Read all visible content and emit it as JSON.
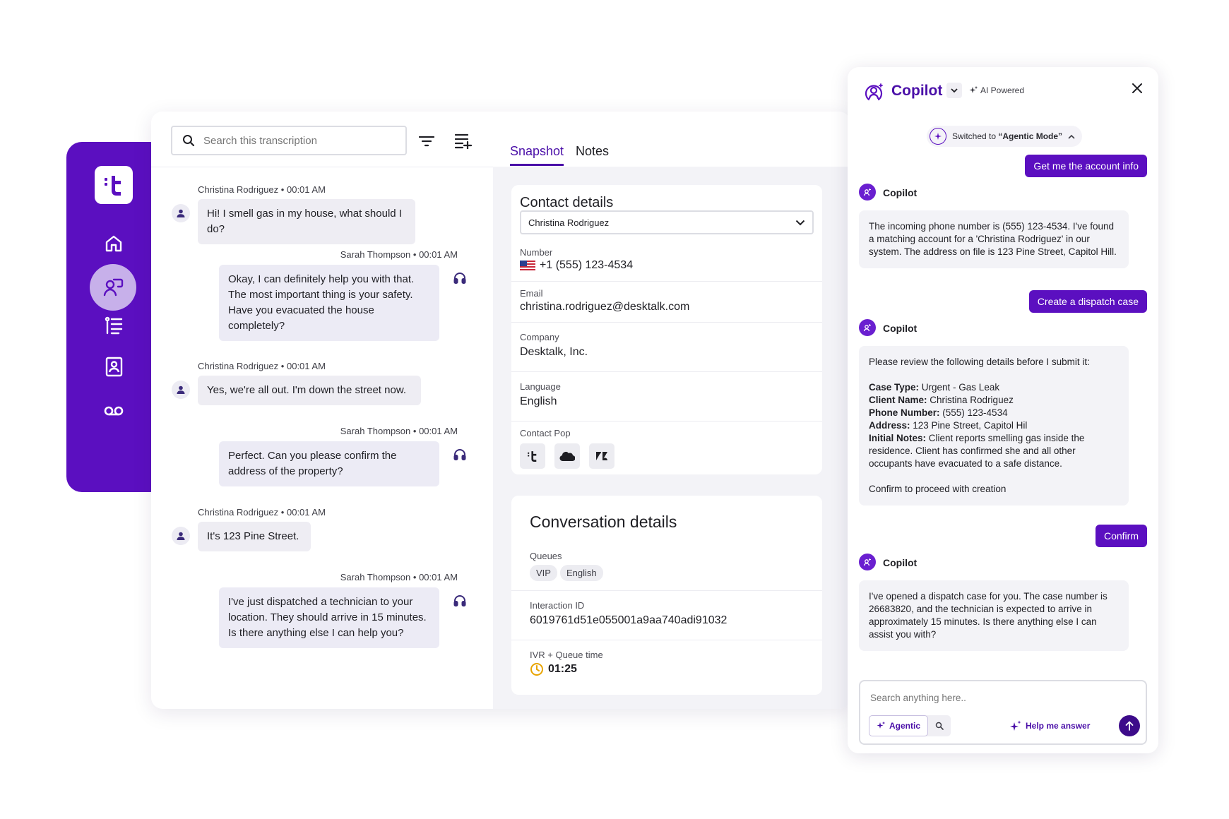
{
  "colors": {
    "brand": "#5b0fc0",
    "brand_dark": "#4a0fa8",
    "bubble": "#eeedf3",
    "clock": "#e8a400"
  },
  "sidebar": {
    "logo_icon": "brand-logo-icon",
    "items": [
      {
        "icon": "home-icon"
      },
      {
        "icon": "conversations-icon",
        "active": true
      },
      {
        "icon": "list-icon"
      },
      {
        "icon": "contacts-book-icon"
      },
      {
        "icon": "voicemail-icon"
      }
    ]
  },
  "transcript": {
    "search_placeholder": "Search this transcription",
    "messages": [
      {
        "speaker": "Christina Rodriguez",
        "time": "00:01 AM",
        "role": "customer",
        "text": "Hi! I smell gas in my house, what should I do?"
      },
      {
        "speaker": "Sarah Thompson",
        "time": "00:01 AM",
        "role": "agent",
        "text": "Okay, I can definitely help you with that. The most important thing is your safety. Have you evacuated the house completely?"
      },
      {
        "speaker": "Christina Rodriguez",
        "time": "00:01 AM",
        "role": "customer",
        "text": "Yes, we're all out. I'm down the street now."
      },
      {
        "speaker": "Sarah Thompson",
        "time": "00:01 AM",
        "role": "agent",
        "text": "Perfect. Can you please confirm the address of the property?"
      },
      {
        "speaker": "Christina Rodriguez",
        "time": "00:01 AM",
        "role": "customer",
        "text": "It's 123 Pine Street."
      },
      {
        "speaker": "Sarah Thompson",
        "time": "00:01 AM",
        "role": "agent",
        "text": "I've just dispatched a technician to your location. They should arrive in 15 minutes. Is there anything else I can help you?"
      }
    ],
    "separator": "•"
  },
  "tabs": {
    "snapshot": "Snapshot",
    "notes": "Notes"
  },
  "contact": {
    "title": "Contact details",
    "selected_contact": "Christina Rodriguez",
    "number_label": "Number",
    "number_value": "+1 (555) 123-4534",
    "email_label": "Email",
    "email_value": "christina.rodriguez@desktalk.com",
    "company_label": "Company",
    "company_value": "Desktalk, Inc.",
    "language_label": "Language",
    "language_value": "English",
    "contact_pop_label": "Contact Pop"
  },
  "conversation": {
    "title": "Conversation details",
    "queues_label": "Queues",
    "queues": [
      "VIP",
      "English"
    ],
    "interaction_label": "Interaction ID",
    "interaction_value": "6019761d51e055001a9aa740adi91032",
    "ivr_label": "IVR + Queue time",
    "ivr_value": "01:25"
  },
  "copilot": {
    "title": "Copilot",
    "ai_powered": "AI Powered",
    "mode_prefix": "Switched to ",
    "mode_name": "“Agentic Mode”",
    "bot_name": "Copilot",
    "user_msg_1": "Get me the account info",
    "bot_msg_1": "The incoming phone number is (555) 123-4534. I've found a matching account for a 'Christina Rodriguez' in our system. The address on file is 123 Pine Street, Capitol Hill.",
    "user_msg_2": "Create a dispatch case",
    "bot_msg_2_intro": "Please review the following details before I submit it:",
    "case_type_label": "Case Type:",
    "case_type_value": " Urgent - Gas Leak",
    "client_name_label": "Client Name:",
    "client_name_value": " Christina Rodriguez",
    "phone_label": "Phone Number:",
    "phone_value": " (555) 123-4534",
    "address_label": "Address:",
    "address_value": " 123 Pine Street, Capitol Hil",
    "notes_label": "Initial Notes:",
    "notes_value": " Client reports smelling gas inside the residence. Client has confirmed she and all other occupants have evacuated to a safe distance.",
    "bot_msg_2_outro": "Confirm to proceed with creation",
    "user_msg_3": "Confirm",
    "bot_msg_3": "I've opened a dispatch case for you. The case number is 26683820, and the technician is expected to arrive in approximately 15 minutes. Is there anything else I can assist you with?",
    "input_placeholder": "Search anything here..",
    "agentic_label": "Agentic",
    "help_label": "Help me answer"
  }
}
